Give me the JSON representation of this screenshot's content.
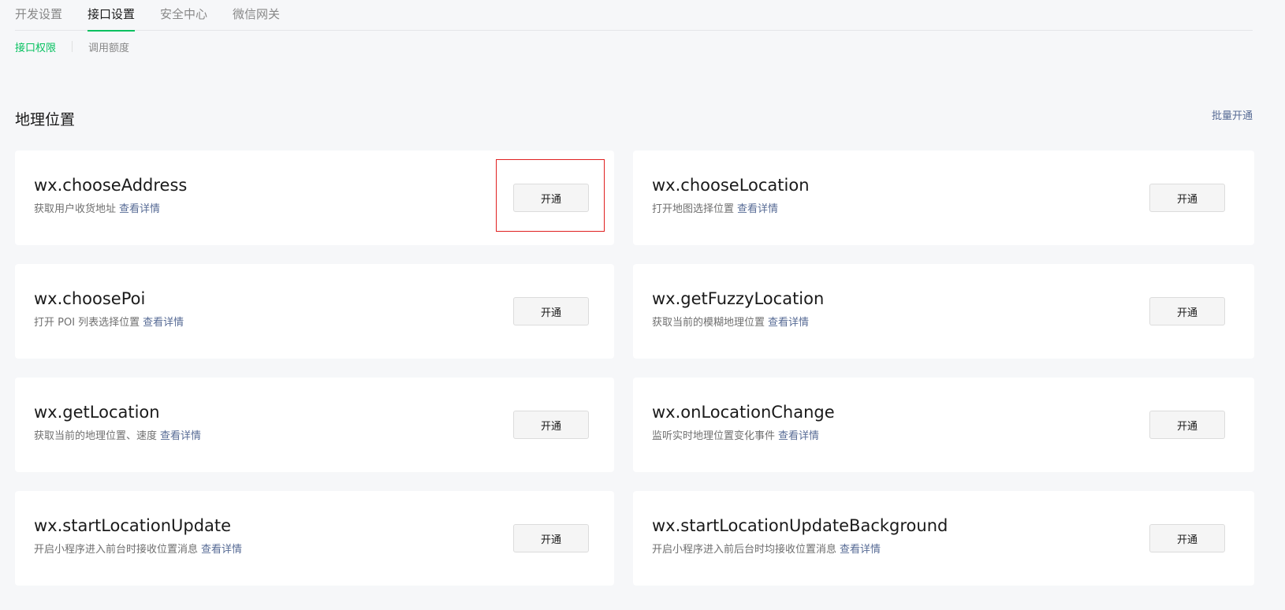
{
  "tabs": [
    {
      "label": "开发设置"
    },
    {
      "label": "接口设置",
      "active": true
    },
    {
      "label": "安全中心"
    },
    {
      "label": "微信网关"
    }
  ],
  "subtabs": [
    {
      "label": "接口权限",
      "active": true
    },
    {
      "label": "调用额度"
    }
  ],
  "section": {
    "title": "地理位置",
    "batch_label": "批量开通"
  },
  "detail_label": "查看详情",
  "apis": [
    {
      "name": "wx.chooseAddress",
      "desc": "获取用户收货地址",
      "button": "开通"
    },
    {
      "name": "wx.chooseLocation",
      "desc": "打开地图选择位置",
      "button": "开通"
    },
    {
      "name": "wx.choosePoi",
      "desc": "打开 POI 列表选择位置",
      "button": "开通"
    },
    {
      "name": "wx.getFuzzyLocation",
      "desc": "获取当前的模糊地理位置",
      "button": "开通"
    },
    {
      "name": "wx.getLocation",
      "desc": "获取当前的地理位置、速度",
      "button": "开通"
    },
    {
      "name": "wx.onLocationChange",
      "desc": "监听实时地理位置变化事件",
      "button": "开通"
    },
    {
      "name": "wx.startLocationUpdate",
      "desc": "开启小程序进入前台时接收位置消息",
      "button": "开通"
    },
    {
      "name": "wx.startLocationUpdateBackground",
      "desc": "开启小程序进入前后台时均接收位置消息",
      "button": "开通"
    }
  ],
  "colors": {
    "accent": "#07c160",
    "link": "#576b95",
    "highlight": "#e02020"
  }
}
